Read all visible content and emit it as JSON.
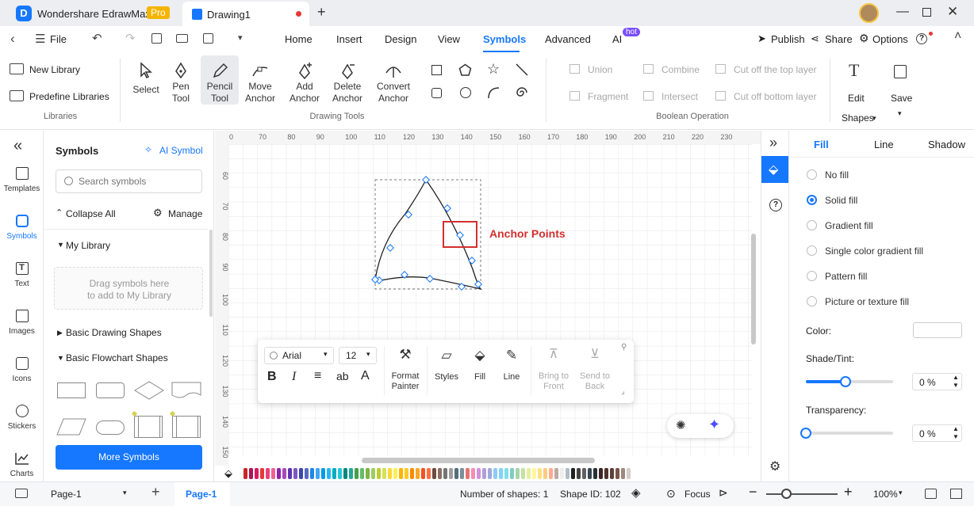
{
  "app": {
    "name": "Wondershare EdrawMax",
    "badge": "Pro",
    "tab_title": "Drawing1"
  },
  "menu": {
    "file": "File",
    "tabs": [
      "Home",
      "Insert",
      "Design",
      "View",
      "Symbols",
      "Advanced",
      "AI"
    ],
    "ai_badge": "hot",
    "publish": "Publish",
    "share": "Share",
    "options": "Options"
  },
  "ribbon": {
    "libraries": {
      "new_library": "New Library",
      "predefine": "Predefine Libraries",
      "group": "Libraries"
    },
    "drawing": {
      "select": "Select",
      "pen": [
        "Pen",
        "Tool"
      ],
      "pencil": [
        "Pencil",
        "Tool"
      ],
      "move": [
        "Move",
        "Anchor"
      ],
      "add": [
        "Add",
        "Anchor"
      ],
      "delete": [
        "Delete",
        "Anchor"
      ],
      "convert": [
        "Convert",
        "Anchor"
      ],
      "group": "Drawing Tools"
    },
    "boolean": {
      "union": "Union",
      "combine": "Combine",
      "cut_top": "Cut off the top layer",
      "fragment": "Fragment",
      "intersect": "Intersect",
      "cut_bottom": "Cut off bottom layer",
      "group": "Boolean Operation"
    },
    "edit": "Edit",
    "shapes": "Shapes",
    "save": "Save"
  },
  "rail": [
    "Templates",
    "Symbols",
    "Text",
    "Images",
    "Icons",
    "Stickers",
    "Charts"
  ],
  "symbols_panel": {
    "title": "Symbols",
    "ai_symbol": "AI Symbol",
    "search_placeholder": "Search symbols",
    "collapse_all": "Collapse All",
    "manage": "Manage",
    "my_library": "My Library",
    "drop_hint": "Drag symbols here\nto add to My Library",
    "basic_drawing": "Basic Drawing Shapes",
    "basic_flowchart": "Basic Flowchart Shapes",
    "more": "More Symbols"
  },
  "ruler": {
    "h": [
      "0",
      "70",
      "80",
      "90",
      "100",
      "110",
      "120",
      "130",
      "140",
      "150",
      "160",
      "170",
      "180",
      "190",
      "200",
      "210",
      "220",
      "230"
    ],
    "v": [
      "60",
      "70",
      "80",
      "90",
      "100",
      "110",
      "120",
      "130",
      "140",
      "150"
    ]
  },
  "annotation": "Anchor Points",
  "float_toolbar": {
    "font": "Arial",
    "size": "12",
    "format_painter": [
      "Format",
      "Painter"
    ],
    "styles": "Styles",
    "fill": "Fill",
    "line": "Line",
    "bring_front": [
      "Bring to",
      "Front"
    ],
    "send_back": [
      "Send to",
      "Back"
    ]
  },
  "props": {
    "tabs": [
      "Fill",
      "Line",
      "Shadow"
    ],
    "options": [
      "No fill",
      "Solid fill",
      "Gradient fill",
      "Single color gradient fill",
      "Pattern fill",
      "Picture or texture fill"
    ],
    "selected": "Solid fill",
    "color_label": "Color:",
    "shade_label": "Shade/Tint:",
    "shade_value": "0 %",
    "shade_level": 0.45,
    "transparency_label": "Transparency:",
    "transparency_value": "0 %",
    "transparency_level": 0
  },
  "status": {
    "page_select": "Page-1",
    "page_tab": "Page-1",
    "num_shapes": "Number of shapes: 1",
    "shape_id": "Shape ID: 102",
    "focus": "Focus",
    "zoom": "100%"
  },
  "colors": {
    "accent": "#1677ff",
    "annotation": "#d32f2f",
    "pro_badge": "#f5b400"
  }
}
